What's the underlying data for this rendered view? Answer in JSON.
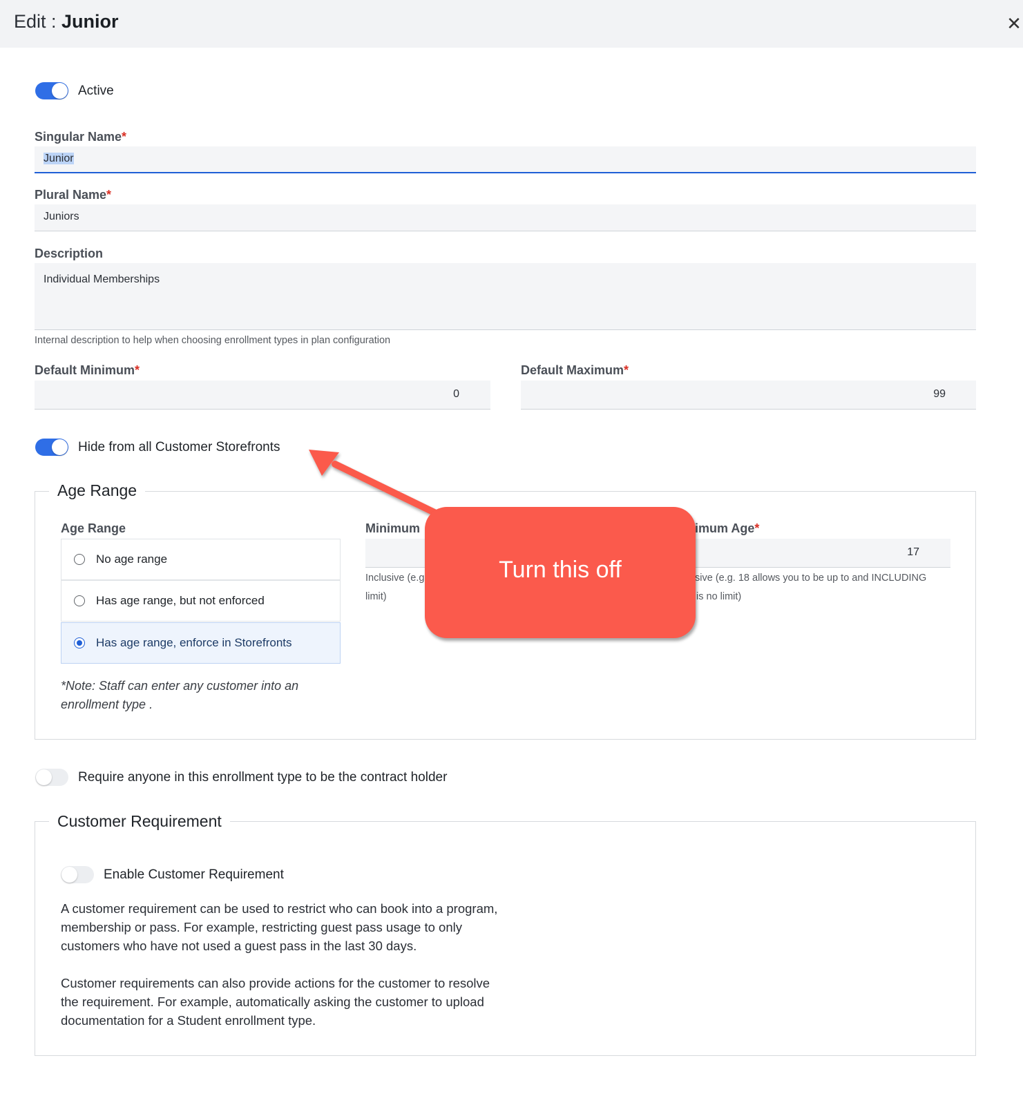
{
  "header": {
    "title_prefix": "Edit : ",
    "title_name": "Junior"
  },
  "active_toggle": {
    "label": "Active",
    "on": true
  },
  "singular": {
    "label": "Singular Name",
    "required": "*",
    "value": "Junior"
  },
  "plural": {
    "label": "Plural Name",
    "required": "*",
    "value": "Juniors"
  },
  "description": {
    "label": "Description",
    "value": "Individual Memberships",
    "hint": "Internal description to help when choosing enrollment types in plan configuration"
  },
  "default_min": {
    "label": "Default Minimum",
    "required": "*",
    "value": "0"
  },
  "default_max": {
    "label": "Default Maximum",
    "required": "*",
    "value": "99"
  },
  "hide_toggle": {
    "label": "Hide from all Customer Storefronts",
    "on": true
  },
  "age_range": {
    "legend": "Age Range",
    "radio_label": "Age Range",
    "options": [
      {
        "label": "No age range",
        "selected": false
      },
      {
        "label": "Has age range, but not enforced",
        "selected": false
      },
      {
        "label": "Has age range, enforce in Storefronts",
        "selected": true
      }
    ],
    "note": "*Note: Staff can enter any customer into an enrollment type .",
    "min_label": "Minimum",
    "min_hint_1": "Inclusive (e.g",
    "min_hint_2": "limit)",
    "max_label": "imum Age",
    "max_required": "*",
    "max_value": "17",
    "max_hint_1": "sive (e.g. 18 allows you to be up to and INCLUDING",
    "max_hint_2": "is no limit)"
  },
  "callout": {
    "text": "Turn this off"
  },
  "contract_toggle": {
    "label": "Require anyone in this enrollment type to be the contract holder",
    "on": false
  },
  "customer_req": {
    "legend": "Customer Requirement",
    "toggle_label": "Enable Customer Requirement",
    "para1": "A customer requirement can be used to restrict who can book into a program, membership or pass. For example, restricting guest pass usage to only customers who have not used a guest pass in the last 30 days.",
    "para2": "Customer requirements can also provide actions for the customer to resolve the requirement. For example, automatically asking the customer to upload documentation for a Student enrollment type."
  },
  "colors": {
    "accent": "#2f6ee6",
    "callout": "#fb5a4c",
    "required": "#d93025"
  },
  "icons": {
    "close": "close-icon"
  }
}
